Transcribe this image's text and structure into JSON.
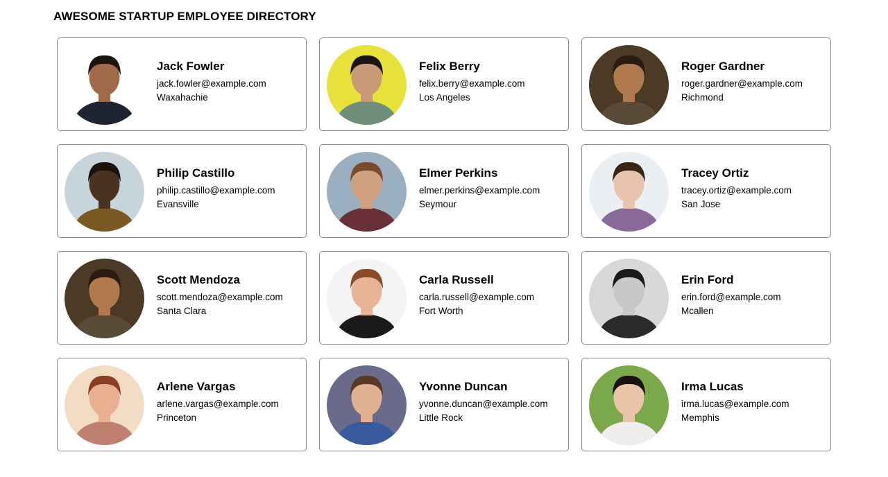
{
  "header": {
    "title": "AWESOME STARTUP EMPLOYEE DIRECTORY"
  },
  "employees": [
    {
      "name": "Jack Fowler",
      "email": "jack.fowler@example.com",
      "city": "Waxahachie",
      "bg": "#ffffff",
      "skin": "#a0694a",
      "hair": "#1c1410",
      "shirt": "#1f2530"
    },
    {
      "name": "Felix Berry",
      "email": "felix.berry@example.com",
      "city": "Los Angeles",
      "bg": "#e6e23a",
      "skin": "#c99a78",
      "hair": "#1a1512",
      "shirt": "#6f8f7a"
    },
    {
      "name": "Roger Gardner",
      "email": "roger.gardner@example.com",
      "city": "Richmond",
      "bg": "#4a3a26",
      "skin": "#b07a4e",
      "hair": "#2a1c10",
      "shirt": "#5a4a38"
    },
    {
      "name": "Philip Castillo",
      "email": "philip.castillo@example.com",
      "city": "Evansville",
      "bg": "#c8d4dc",
      "skin": "#4a3220",
      "hair": "#1a120c",
      "shirt": "#7a5a22"
    },
    {
      "name": "Elmer Perkins",
      "email": "elmer.perkins@example.com",
      "city": "Seymour",
      "bg": "#9ab0c0",
      "skin": "#d0a080",
      "hair": "#7a4a2a",
      "shirt": "#6a3038"
    },
    {
      "name": "Tracey Ortiz",
      "email": "tracey.ortiz@example.com",
      "city": "San Jose",
      "bg": "#eceff2",
      "skin": "#e8c4ae",
      "hair": "#3a2418",
      "shirt": "#8a6a9a"
    },
    {
      "name": "Scott Mendoza",
      "email": "scott.mendoza@example.com",
      "city": "Santa Clara",
      "bg": "#4a3a26",
      "skin": "#b07a4e",
      "hair": "#2a1c10",
      "shirt": "#5a4a38"
    },
    {
      "name": "Carla Russell",
      "email": "carla.russell@example.com",
      "city": "Fort Worth",
      "bg": "#f4f4f4",
      "skin": "#e8b498",
      "hair": "#8a4a26",
      "shirt": "#1a1a1a"
    },
    {
      "name": "Erin Ford",
      "email": "erin.ford@example.com",
      "city": "Mcallen",
      "bg": "#d8d8d8",
      "skin": "#c8c8c8",
      "hair": "#1a1a1a",
      "shirt": "#2a2a2a"
    },
    {
      "name": "Arlene Vargas",
      "email": "arlene.vargas@example.com",
      "city": "Princeton",
      "bg": "#f2dcc4",
      "skin": "#e8b090",
      "hair": "#8a4020",
      "shirt": "#c08070"
    },
    {
      "name": "Yvonne Duncan",
      "email": "yvonne.duncan@example.com",
      "city": "Little Rock",
      "bg": "#6a6a8a",
      "skin": "#e0b090",
      "hair": "#5a3a26",
      "shirt": "#3a5aa0"
    },
    {
      "name": "Irma Lucas",
      "email": "irma.lucas@example.com",
      "city": "Memphis",
      "bg": "#7aa84a",
      "skin": "#eac4a8",
      "hair": "#1a1210",
      "shirt": "#f0eeec"
    }
  ]
}
